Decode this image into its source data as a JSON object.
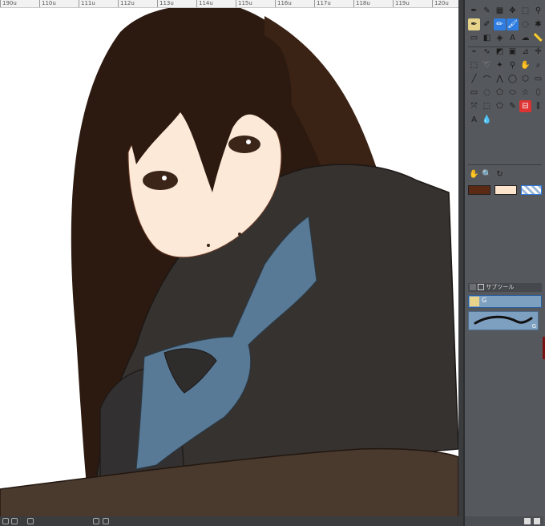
{
  "ruler": {
    "labels": [
      "190u",
      "110u",
      "111u",
      "112u",
      "113u",
      "114u",
      "115u",
      "116u",
      "117u",
      "118u",
      "119u",
      "120u"
    ]
  },
  "toolbox": {
    "rows": [
      [
        "pen-icon",
        "brush-icon",
        "tone-icon",
        "move-icon",
        "select-icon",
        "eyedropper-icon"
      ],
      [
        "g-pen-icon",
        "marker-icon",
        "pencil-icon",
        "brush-tool-icon",
        "airbrush-icon",
        "decoration-icon"
      ],
      [
        "eraser-icon",
        "gradient-icon",
        "fill-icon",
        "text-icon",
        "balloon-icon",
        "ruler-icon"
      ],
      [
        "vector-icon",
        "correct-line-icon",
        "figure-icon",
        "frame-icon",
        "ruler-tool-icon",
        "layer-move-icon"
      ],
      [
        "selection-icon",
        "lasso-icon",
        "auto-select-icon",
        "eyedrop-icon",
        "hand-icon",
        "zoom-icon"
      ],
      [
        "line-icon",
        "curve-icon",
        "polyline-icon",
        "ellipse-icon",
        "polygon-icon",
        "rectangle-icon"
      ],
      [
        "rect-select-icon",
        "lasso-select-icon",
        "polygon-select-icon",
        "ellipse-select-icon",
        "star-icon",
        "shape-icon"
      ],
      [
        "transform-icon",
        "rect-marquee-icon",
        "free-select-icon",
        "selection-pen-icon",
        "shrink-select-icon",
        "split-icon"
      ],
      [
        "text-tool-icon",
        "drop-icon"
      ]
    ],
    "bottom_row": [
      "hand-tool-icon",
      "zoom-tool-icon",
      "rotate-icon"
    ],
    "selected": [
      "pencil-icon",
      "brush-tool-icon"
    ]
  },
  "colors": {
    "main": "#5a2a15",
    "sub": "#fde4cc",
    "transparent_label": "transparent",
    "hair": "#2c1a10",
    "skin": "#fde9d8",
    "coat": "#353230",
    "scarf": "#587a96",
    "floor": "#4a3a2e",
    "panel_bg": "#55585c",
    "accent": "#2f7de1"
  },
  "sub_tool": {
    "tab_label": "サブツール",
    "item_label": "G",
    "preview_label": "G"
  }
}
